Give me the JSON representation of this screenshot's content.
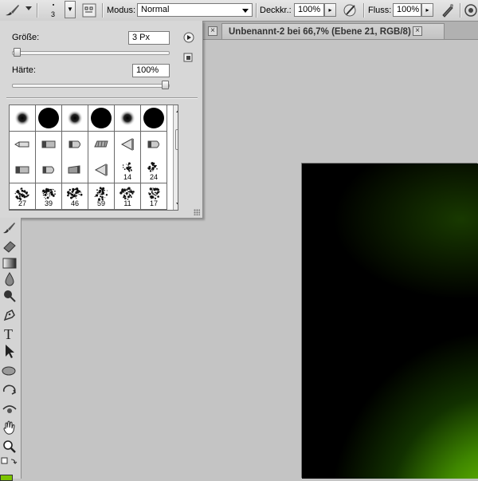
{
  "options_bar": {
    "brush_size": "3",
    "mode_label": "Modus:",
    "mode_value": "Normal",
    "opacity_label": "Deckkr.:",
    "opacity_value": "100%",
    "flow_label": "Fluss:",
    "flow_value": "100%"
  },
  "document": {
    "tab_title": "Unbenannt-2 bei 66,7% (Ebene 21, RGB/8) *"
  },
  "brush_panel": {
    "size_label": "Größe:",
    "size_value": "3 Px",
    "size_level": 0.01,
    "hardness_label": "Härte:",
    "hardness_value": "100%",
    "hardness_level": 1.0,
    "presets": [
      {
        "kind": "soft",
        "label": ""
      },
      {
        "kind": "hard",
        "label": ""
      },
      {
        "kind": "soft",
        "label": ""
      },
      {
        "kind": "hard",
        "label": ""
      },
      {
        "kind": "soft",
        "label": ""
      },
      {
        "kind": "hard",
        "label": ""
      },
      {
        "kind": "tip-pencil",
        "label": ""
      },
      {
        "kind": "tip-flat",
        "label": ""
      },
      {
        "kind": "tip-round",
        "label": ""
      },
      {
        "kind": "tip-fan",
        "label": ""
      },
      {
        "kind": "tip-cone",
        "label": ""
      },
      {
        "kind": "tip-round",
        "label": ""
      },
      {
        "kind": "tip-flat",
        "label": ""
      },
      {
        "kind": "tip-round",
        "label": ""
      },
      {
        "kind": "tip-angle",
        "label": ""
      },
      {
        "kind": "tip-cone",
        "label": ""
      },
      {
        "kind": "scatter",
        "label": "14"
      },
      {
        "kind": "scatter",
        "label": "24"
      },
      {
        "kind": "splatter",
        "label": "27"
      },
      {
        "kind": "splatter",
        "label": "39"
      },
      {
        "kind": "splatter",
        "label": "46"
      },
      {
        "kind": "splatter",
        "label": "59"
      },
      {
        "kind": "splatter",
        "label": "11"
      },
      {
        "kind": "splatter",
        "label": "17"
      }
    ]
  },
  "toolbar": {
    "tools": [
      "brush-icon",
      "eraser-icon",
      "gradient-icon",
      "blur-drop-icon",
      "dodge-icon",
      "pen-icon",
      "type-icon",
      "path-select-icon",
      "ellipse-icon",
      "rotate-3d-icon",
      "orbit-3d-icon",
      "hand-icon",
      "zoom-icon"
    ]
  },
  "colors": {
    "canvas_bg": "#000000",
    "canvas_glow": "#7fd200",
    "foreground_swatch": "#7cc400"
  }
}
